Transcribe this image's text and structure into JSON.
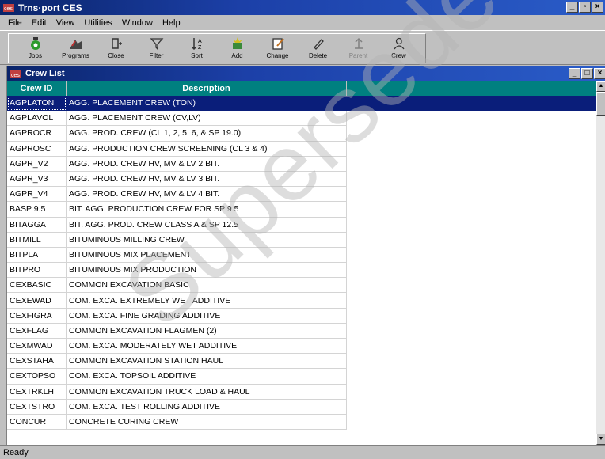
{
  "app": {
    "title": "Trns·port CES",
    "icon": "ces-app-icon",
    "window_buttons": [
      "_",
      " ☐",
      "×"
    ]
  },
  "menubar": {
    "items": [
      {
        "label": "File"
      },
      {
        "label": "Edit"
      },
      {
        "label": "View"
      },
      {
        "label": "Utilities"
      },
      {
        "label": "Window"
      },
      {
        "label": "Help"
      }
    ]
  },
  "toolbar": {
    "buttons": [
      {
        "label": "Jobs",
        "icon": "jobs-icon",
        "enabled": true
      },
      {
        "label": "Programs",
        "icon": "programs-icon",
        "enabled": true
      },
      {
        "label": "Close",
        "icon": "close-icon",
        "enabled": true
      },
      {
        "label": "Filter",
        "icon": "filter-icon",
        "enabled": true
      },
      {
        "label": "Sort",
        "icon": "sort-icon",
        "enabled": true
      },
      {
        "label": "Add",
        "icon": "add-icon",
        "enabled": true
      },
      {
        "label": "Change",
        "icon": "change-icon",
        "enabled": true
      },
      {
        "label": "Delete",
        "icon": "delete-icon",
        "enabled": true
      },
      {
        "label": "Parent",
        "icon": "parent-icon",
        "enabled": false
      },
      {
        "label": "Crew",
        "icon": "crew-icon",
        "enabled": true
      }
    ]
  },
  "crew_list": {
    "title": "Crew List",
    "columns": [
      "Crew ID",
      "Description"
    ],
    "selected_index": 0,
    "rows": [
      {
        "id": "AGPLATON",
        "desc": "AGG. PLACEMENT CREW (TON)"
      },
      {
        "id": "AGPLAVOL",
        "desc": "AGG. PLACEMENT CREW (CV,LV)"
      },
      {
        "id": "AGPROCR",
        "desc": "AGG. PROD. CREW (CL 1, 2, 5, 6, & SP 19.0)"
      },
      {
        "id": "AGPROSC",
        "desc": "AGG. PRODUCTION CREW SCREENING (CL 3 & 4)"
      },
      {
        "id": "AGPR_V2",
        "desc": "AGG. PROD. CREW HV, MV & LV 2 BIT."
      },
      {
        "id": "AGPR_V3",
        "desc": "AGG. PROD. CREW HV, MV & LV 3 BIT."
      },
      {
        "id": "AGPR_V4",
        "desc": "AGG. PROD. CREW HV, MV & LV 4 BIT."
      },
      {
        "id": "BASP 9.5",
        "desc": "BIT. AGG. PRODUCTION CREW FOR SP 9.5"
      },
      {
        "id": "BITAGGA",
        "desc": "BIT. AGG. PROD. CREW CLASS A & SP 12.5"
      },
      {
        "id": "BITMILL",
        "desc": "BITUMINOUS MILLING CREW"
      },
      {
        "id": "BITPLA",
        "desc": "BITUMINOUS MIX PLACEMENT"
      },
      {
        "id": "BITPRO",
        "desc": "BITUMINOUS MIX PRODUCTION"
      },
      {
        "id": "CEXBASIC",
        "desc": "COMMON EXCAVATION BASIC"
      },
      {
        "id": "CEXEWAD",
        "desc": "COM. EXCA. EXTREMELY WET ADDITIVE"
      },
      {
        "id": "CEXFIGRA",
        "desc": "COM. EXCA. FINE GRADING ADDITIVE"
      },
      {
        "id": "CEXFLAG",
        "desc": "COMMON EXCAVATION FLAGMEN (2)"
      },
      {
        "id": "CEXMWAD",
        "desc": "COM. EXCA. MODERATELY WET ADDITIVE"
      },
      {
        "id": "CEXSTAHA",
        "desc": "COMMON EXCAVATION STATION HAUL"
      },
      {
        "id": "CEXTOPSO",
        "desc": "COM. EXCA. TOPSOIL ADDITIVE"
      },
      {
        "id": "CEXTRKLH",
        "desc": "COMMON EXCAVATION TRUCK LOAD &  HAUL"
      },
      {
        "id": "CEXTSTRO",
        "desc": "COM. EXCA. TEST ROLLING ADDITIVE"
      },
      {
        "id": "CONCUR",
        "desc": "CONCRETE CURING CREW"
      }
    ]
  },
  "status": {
    "text": "Ready"
  },
  "watermark": {
    "text": "Superseded"
  },
  "colors": {
    "title_bar": "#0a246a",
    "header": "#008080",
    "selection": "#0a1e7a"
  }
}
